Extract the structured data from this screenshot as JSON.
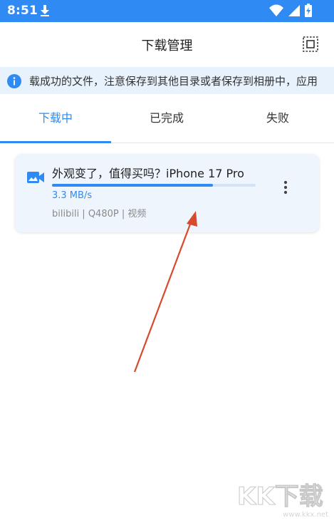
{
  "status_bar": {
    "time": "8:51",
    "icons": [
      "download-icon",
      "wifi-icon",
      "signal-icon",
      "battery-charging-icon"
    ]
  },
  "app_bar": {
    "title": "下载管理",
    "action_icon": "select-all-icon"
  },
  "notice": {
    "icon": "info-icon",
    "text": "载成功的文件，注意保存到其他目录或者保存到相册中，应用"
  },
  "tabs": [
    {
      "label": "下载中",
      "active": true
    },
    {
      "label": "已完成",
      "active": false
    },
    {
      "label": "失败",
      "active": false
    }
  ],
  "downloads": [
    {
      "icon": "video-icon",
      "title": "外观变了，值得买吗？iPhone 17 Pro",
      "progress_percent": 79,
      "speed": "3.3 MB/s",
      "meta": "bilibili | Q480P | 视频",
      "menu_icon": "more-vertical-icon"
    }
  ],
  "watermark": {
    "text": "KK下载",
    "url": "www.kkx.net"
  },
  "colors": {
    "accent": "#2f8bf3",
    "notice_bg": "#e8f2fc",
    "card_bg": "#eef5fd",
    "annotation_arrow": "#d9492c"
  }
}
